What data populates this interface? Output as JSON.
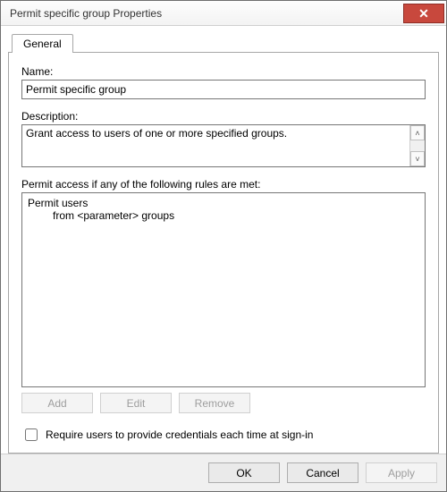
{
  "window": {
    "title": "Permit specific group Properties",
    "close_glyph": "✕"
  },
  "tabs": {
    "general": "General"
  },
  "labels": {
    "name": "Name:",
    "description": "Description:",
    "rules_header": "Permit access if any of the following rules are met:",
    "require_creds": "Require users to provide credentials each time at sign-in"
  },
  "values": {
    "name": "Permit specific group",
    "description": "Grant access to users of one or more specified groups.",
    "rule_line1": "Permit users",
    "rule_line2": "from <parameter> groups"
  },
  "buttons": {
    "add": "Add",
    "edit": "Edit",
    "remove": "Remove",
    "ok": "OK",
    "cancel": "Cancel",
    "apply": "Apply"
  },
  "scroll": {
    "up": "˄",
    "down": "˅"
  }
}
